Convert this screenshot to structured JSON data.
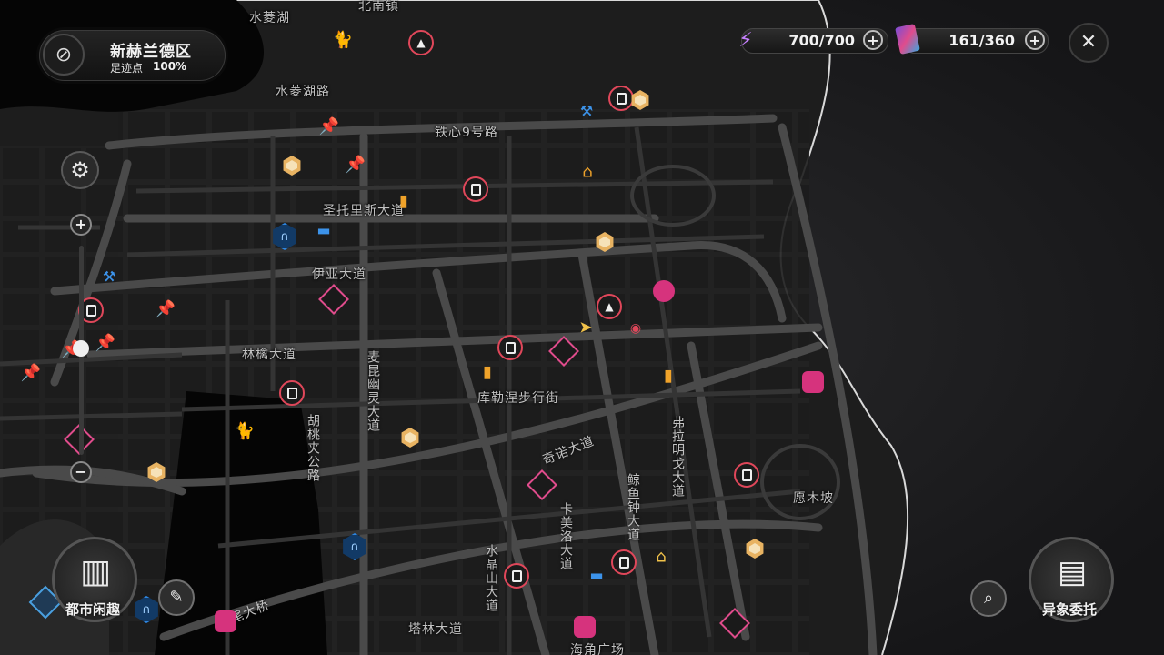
{
  "location": {
    "name": "新赫兰德区",
    "footprint_label": "足迹点",
    "footprint_pct": "100%"
  },
  "resources": [
    {
      "icon": "battery-charge-icon",
      "value": "700/700"
    },
    {
      "icon": "card-icon",
      "value": "161/360"
    }
  ],
  "buttons": {
    "city_fun": "都市闲趣",
    "anomaly_commission": "异象委托",
    "close": "✕",
    "plus": "+",
    "zoom_in": "+",
    "zoom_out": "−",
    "gear": "⚙"
  },
  "map_labels": {
    "shuiling_lake": "水菱湖",
    "beinan_town": "北南镇",
    "shuiling_lake_rd": "水菱湖路",
    "tiexin_rd": "铁心9号路",
    "sttorris_ave": "圣托里斯大道",
    "yia_ave": "伊亚大道",
    "linqiao_ave": "林檎大道",
    "kulenie_street": "库勒涅步行街",
    "qinuo_ave": "奇诺大道",
    "yuanmu_slope": "愿木坡",
    "talin_ave": "塔林大道",
    "haijiao_square": "海角广场",
    "mailun_ave": "麦昆幽灵大道",
    "hutao_rd": "胡桃夹公路",
    "kamei_ave": "卡美洛大道",
    "jingyu_ave": "鲸鱼钟大道",
    "folamingo_ave": "弗拉明戈大道",
    "shuijing_ave": "水晶山大道",
    "bridge": "虹尾大桥"
  },
  "colors": {
    "accent_red": "#e0475a",
    "accent_pink": "#d6337d",
    "accent_blue": "#2f86e0",
    "accent_orange": "#f0a32a"
  }
}
